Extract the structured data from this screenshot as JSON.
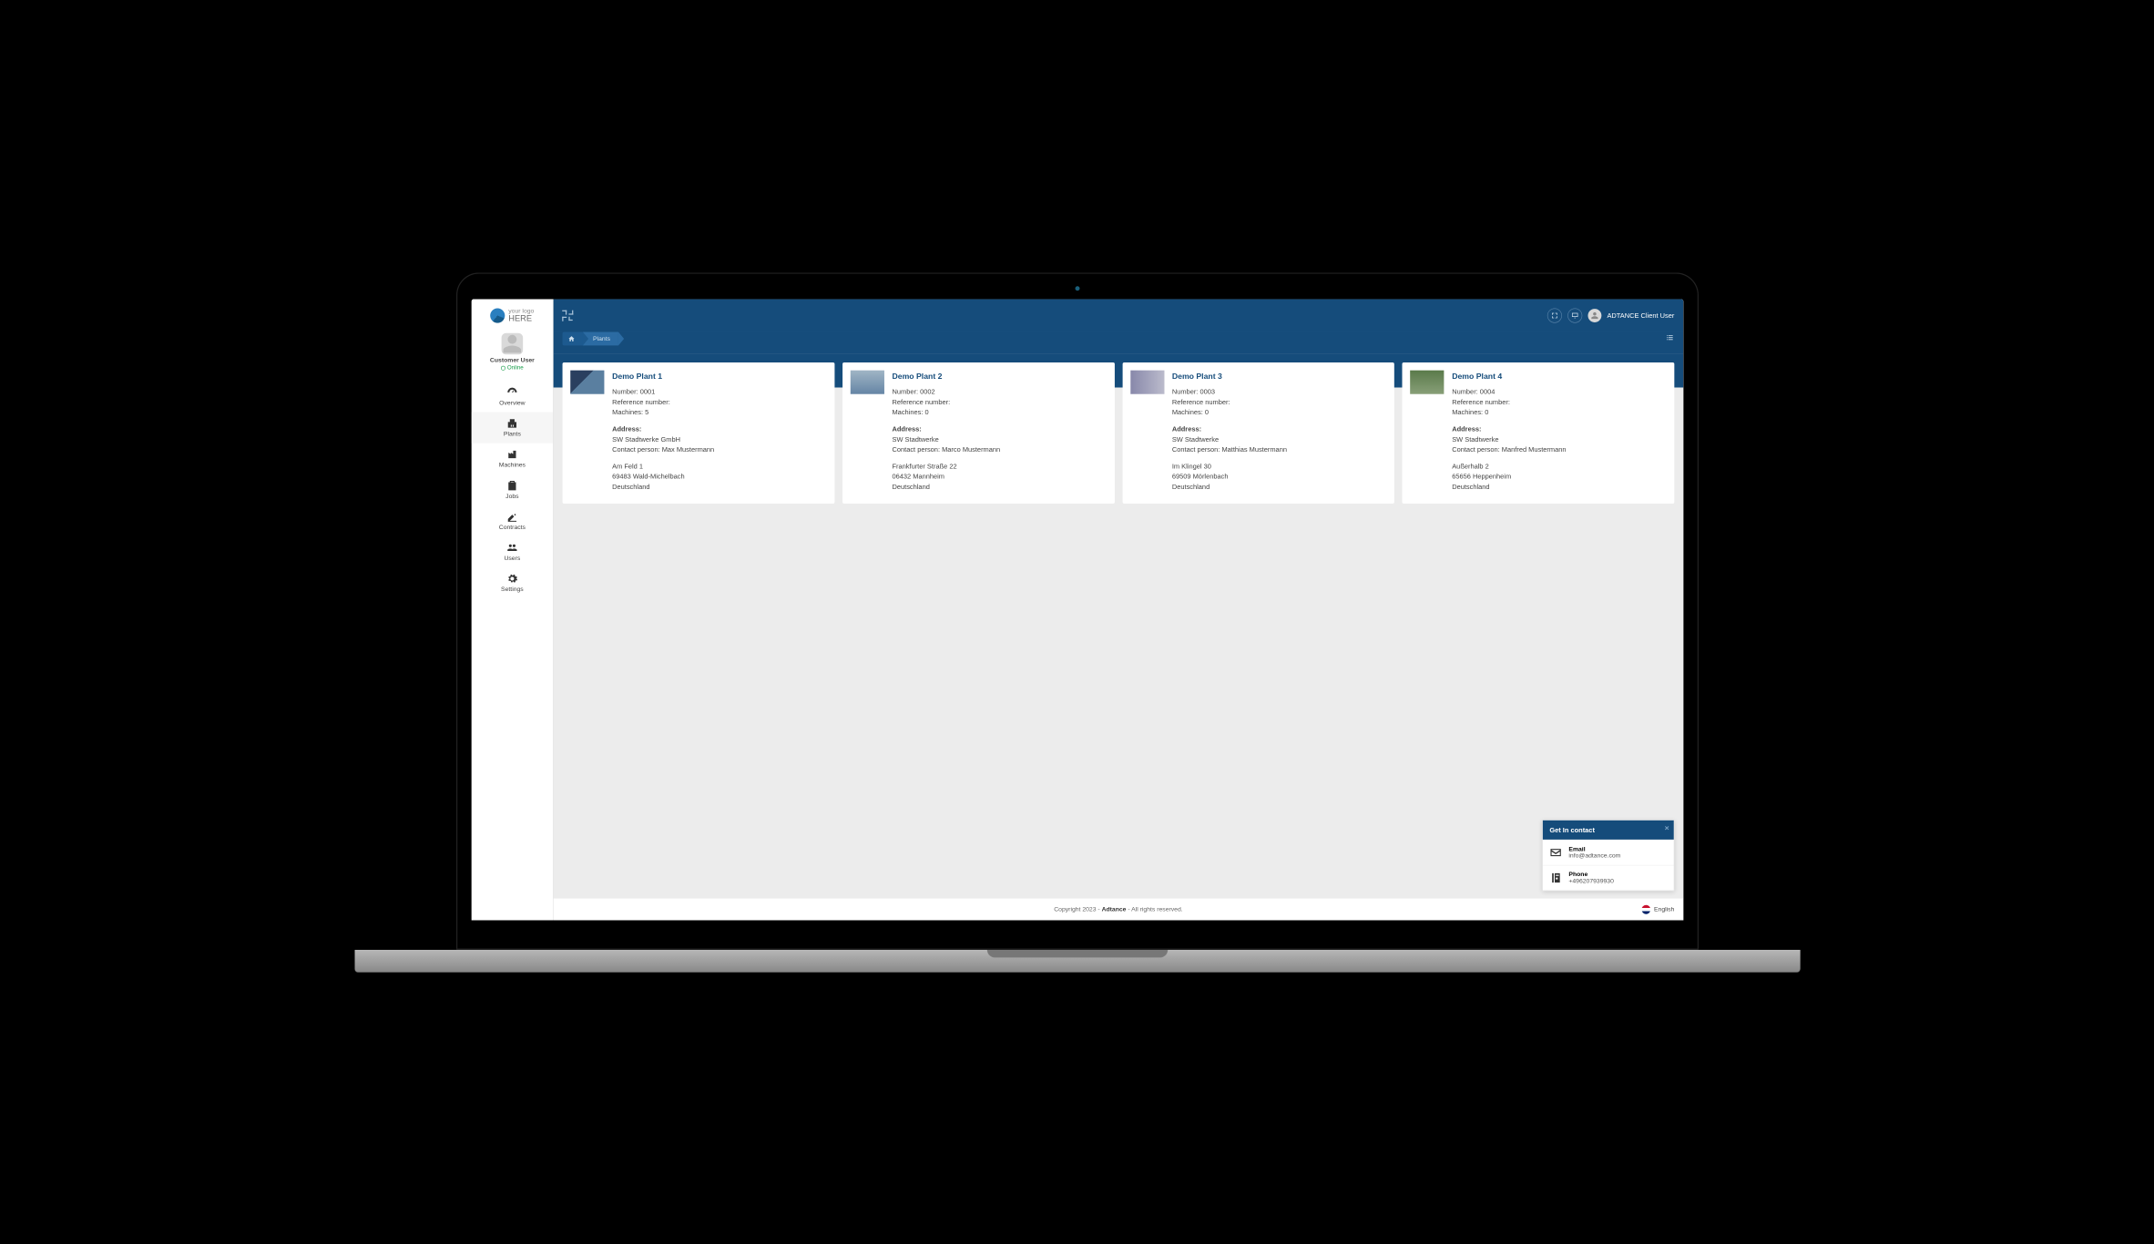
{
  "logo": {
    "line1": "your logo",
    "line2": "HERE"
  },
  "sidebar": {
    "user_name": "Customer User",
    "status": "Online",
    "nav": [
      {
        "label": "Overview"
      },
      {
        "label": "Plants"
      },
      {
        "label": "Machines"
      },
      {
        "label": "Jobs"
      },
      {
        "label": "Contracts"
      },
      {
        "label": "Users"
      },
      {
        "label": "Settings"
      }
    ]
  },
  "topbar": {
    "user": "ADTANCE Client User"
  },
  "breadcrumb": {
    "current": "Plants"
  },
  "labels": {
    "number": "Number: ",
    "reference": "Reference number:",
    "machines": "Machines: ",
    "address": "Address:",
    "contact": "Contact person: "
  },
  "plants": [
    {
      "title": "Demo Plant 1",
      "number": "0001",
      "reference": "",
      "machines": "5",
      "company": "SW Stadtwerke GmbH",
      "contact": "Max Mustermann",
      "street": "Am Feld 1",
      "city": "69483 Wald-Michelbach",
      "country": "Deutschland"
    },
    {
      "title": "Demo Plant 2",
      "number": "0002",
      "reference": "",
      "machines": "0",
      "company": "SW Stadtwerke",
      "contact": "Marco Mustermann",
      "street": "Frankfurter Straße 22",
      "city": "06432 Mannheim",
      "country": "Deutschland"
    },
    {
      "title": "Demo Plant 3",
      "number": "0003",
      "reference": "",
      "machines": "0",
      "company": "SW Stadtwerke",
      "contact": "Matthias Mustermann",
      "street": "Im Klingel 30",
      "city": "69509 Mörlenbach",
      "country": "Deutschland"
    },
    {
      "title": "Demo Plant 4",
      "number": "0004",
      "reference": "",
      "machines": "0",
      "company": "SW Stadtwerke",
      "contact": "Manfred Mustermann",
      "street": "Außerhalb 2",
      "city": "65656 Heppenheim",
      "country": "Deutschland"
    }
  ],
  "contact_widget": {
    "title": "Get In contact",
    "email_label": "Email",
    "email": "info@adtance.com",
    "phone_label": "Phone",
    "phone": "+496207939930"
  },
  "footer": {
    "pre": "Copyright 2023 - ",
    "brand": "Adtance",
    "post": " - All rights reserved.",
    "lang": "English"
  }
}
